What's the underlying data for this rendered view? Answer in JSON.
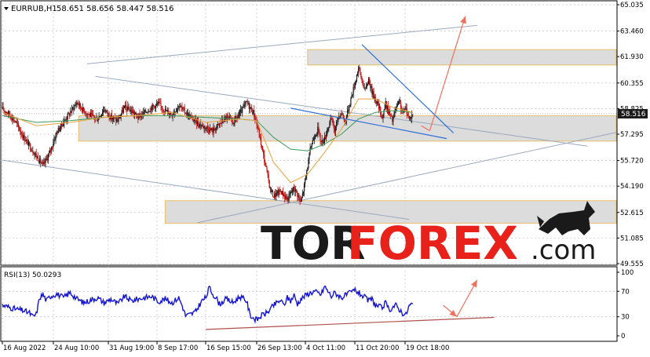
{
  "header": {
    "symbol_label": "EURRUB,H1",
    "ohlc_text": "58.651 58.656 58.447 58.516"
  },
  "watermark": {
    "part1": "TOR",
    "part2": "FOREX",
    "part3": ".com",
    "color_dark": "#1a1a1a",
    "color_accent": "#e8211b"
  },
  "colors": {
    "bull_candle": "#1a1a1a",
    "bear_candle": "#c01010",
    "ma_fast": "#e8a33a",
    "ma_slow": "#3c9a5a",
    "zone_fill": "#d9d9d9",
    "zone_border": "#e6b85a",
    "trend_blue": "#2f6fd6",
    "channel_gray": "#9aa9bf",
    "forecast_red": "#f07060",
    "rsi_line": "#1515d0",
    "rsi_trend": "#b05050"
  },
  "chart_data": {
    "type": "candlestick",
    "symbol": "EURRUB",
    "timeframe": "H1",
    "ylim": [
      49.555,
      65.035
    ],
    "y_ticks": [
      65.035,
      63.46,
      61.93,
      60.355,
      58.825,
      57.295,
      55.72,
      54.19,
      52.615,
      51.085,
      49.555
    ],
    "y_tick_labels": [
      "65.035",
      "63.460",
      "61.930",
      "60.355",
      "58.825",
      "57.295",
      "55.720",
      "54.190",
      "52.615",
      "51.085",
      "49.555"
    ],
    "current_price": 58.516,
    "current_price_label": "58.516",
    "x_tick_labels": [
      "16 Aug 2022",
      "24 Aug 10:00",
      "31 Aug 19:00",
      "8 Sep 17:00",
      "16 Sep 15:00",
      "26 Sep 13:00",
      "4 Oct 11:00",
      "11 Oct 20:00",
      "19 Oct 18:00"
    ],
    "price_path": [
      [
        0,
        58.8
      ],
      [
        4,
        58.5
      ],
      [
        8,
        58.0
      ],
      [
        12,
        57.2
      ],
      [
        16,
        56.6
      ],
      [
        20,
        56.0
      ],
      [
        24,
        55.4
      ],
      [
        28,
        56.2
      ],
      [
        32,
        57.4
      ],
      [
        36,
        58.0
      ],
      [
        40,
        58.6
      ],
      [
        44,
        59.2
      ],
      [
        48,
        58.7
      ],
      [
        52,
        58.4
      ],
      [
        56,
        58.2
      ],
      [
        60,
        58.8
      ],
      [
        64,
        58.3
      ],
      [
        68,
        58.1
      ],
      [
        72,
        58.9
      ],
      [
        76,
        58.7
      ],
      [
        80,
        58.3
      ],
      [
        84,
        58.6
      ],
      [
        88,
        58.9
      ],
      [
        92,
        59.1
      ],
      [
        96,
        58.7
      ],
      [
        100,
        58.5
      ],
      [
        104,
        59.0
      ],
      [
        108,
        58.6
      ],
      [
        112,
        58.2
      ],
      [
        116,
        57.9
      ],
      [
        120,
        57.7
      ],
      [
        124,
        57.5
      ],
      [
        128,
        57.9
      ],
      [
        132,
        58.3
      ],
      [
        136,
        58.0
      ],
      [
        140,
        58.5
      ],
      [
        144,
        59.2
      ],
      [
        148,
        58.6
      ],
      [
        150,
        57.9
      ],
      [
        152,
        57.0
      ],
      [
        154,
        56.0
      ],
      [
        156,
        55.0
      ],
      [
        158,
        54.0
      ],
      [
        160,
        53.6
      ],
      [
        164,
        53.9
      ],
      [
        168,
        53.4
      ],
      [
        172,
        54.1
      ],
      [
        174,
        53.7
      ],
      [
        176,
        53.2
      ],
      [
        178,
        54.2
      ],
      [
        180,
        55.4
      ],
      [
        182,
        56.6
      ],
      [
        184,
        57.2
      ],
      [
        186,
        57.6
      ],
      [
        188,
        56.8
      ],
      [
        190,
        57.0
      ],
      [
        192,
        57.7
      ],
      [
        194,
        58.2
      ],
      [
        196,
        57.5
      ],
      [
        198,
        58.3
      ],
      [
        200,
        58.6
      ],
      [
        202,
        58.0
      ],
      [
        204,
        58.8
      ],
      [
        206,
        59.6
      ],
      [
        208,
        60.4
      ],
      [
        210,
        61.3
      ],
      [
        212,
        60.5
      ],
      [
        214,
        59.9
      ],
      [
        216,
        60.6
      ],
      [
        218,
        59.8
      ],
      [
        220,
        59.4
      ],
      [
        222,
        58.9
      ],
      [
        224,
        58.3
      ],
      [
        226,
        59.1
      ],
      [
        228,
        58.6
      ],
      [
        230,
        58.1
      ],
      [
        232,
        58.8
      ],
      [
        234,
        59.2
      ],
      [
        236,
        58.6
      ],
      [
        238,
        58.8
      ],
      [
        240,
        58.2
      ],
      [
        242,
        58.516
      ]
    ],
    "ma_fast": [
      [
        0,
        58.6
      ],
      [
        20,
        57.8
      ],
      [
        40,
        58.0
      ],
      [
        60,
        58.3
      ],
      [
        80,
        58.4
      ],
      [
        100,
        58.6
      ],
      [
        120,
        58.0
      ],
      [
        140,
        58.2
      ],
      [
        150,
        58.1
      ],
      [
        160,
        55.6
      ],
      [
        170,
        54.4
      ],
      [
        180,
        54.9
      ],
      [
        190,
        56.2
      ],
      [
        200,
        57.6
      ],
      [
        210,
        59.4
      ],
      [
        220,
        59.4
      ],
      [
        230,
        58.9
      ],
      [
        242,
        58.6
      ]
    ],
    "ma_slow": [
      [
        0,
        58.4
      ],
      [
        20,
        58.0
      ],
      [
        40,
        58.1
      ],
      [
        60,
        58.3
      ],
      [
        80,
        58.4
      ],
      [
        100,
        58.4
      ],
      [
        120,
        58.3
      ],
      [
        140,
        58.2
      ],
      [
        150,
        58.1
      ],
      [
        160,
        57.1
      ],
      [
        170,
        56.4
      ],
      [
        180,
        56.3
      ],
      [
        190,
        56.7
      ],
      [
        200,
        57.3
      ],
      [
        210,
        58.2
      ],
      [
        220,
        58.6
      ],
      [
        230,
        58.7
      ],
      [
        242,
        58.6
      ]
    ],
    "zones": [
      {
        "x0": 180,
        "x1": 362,
        "y0": 61.43,
        "y1": 62.35
      },
      {
        "x0": 45,
        "x1": 362,
        "y0": 56.88,
        "y1": 58.4
      },
      {
        "x0": 96,
        "x1": 362,
        "y0": 51.97,
        "y1": 53.32
      }
    ],
    "lines": [
      {
        "kind": "channel",
        "x0": 50,
        "y0": 61.5,
        "x1": 280,
        "y1": 63.8
      },
      {
        "kind": "channel",
        "x0": 55,
        "y0": 60.75,
        "x1": 345,
        "y1": 56.58
      },
      {
        "kind": "channel",
        "x0": 0,
        "y0": 55.74,
        "x1": 240,
        "y1": 52.2
      },
      {
        "kind": "channel",
        "x0": 115,
        "y0": 52.0,
        "x1": 362,
        "y1": 57.4
      },
      {
        "kind": "trend",
        "x0": 170,
        "y0": 58.85,
        "x1": 262,
        "y1": 57.03
      },
      {
        "kind": "trend",
        "x0": 212,
        "y0": 62.65,
        "x1": 266,
        "y1": 57.37
      },
      {
        "kind": "forecast",
        "x0": 252,
        "y0": 57.5,
        "x1": 273,
        "y1": 64.35
      }
    ],
    "forecast_small_line": [
      [
        247,
        57.8
      ],
      [
        252,
        57.5
      ]
    ],
    "rsi": {
      "label": "RSI(13) 50.0293",
      "ylim": [
        0,
        100
      ],
      "y_ticks": [
        100,
        70,
        30,
        0
      ],
      "y_tick_labels": [
        "100",
        "70",
        "30",
        "0"
      ],
      "values": [
        [
          0,
          48
        ],
        [
          4,
          45
        ],
        [
          8,
          42
        ],
        [
          12,
          40
        ],
        [
          16,
          36
        ],
        [
          18,
          30
        ],
        [
          20,
          34
        ],
        [
          22,
          60
        ],
        [
          24,
          65
        ],
        [
          26,
          55
        ],
        [
          28,
          62
        ],
        [
          32,
          66
        ],
        [
          36,
          60
        ],
        [
          40,
          68
        ],
        [
          44,
          58
        ],
        [
          48,
          52
        ],
        [
          52,
          56
        ],
        [
          56,
          60
        ],
        [
          60,
          52
        ],
        [
          64,
          58
        ],
        [
          68,
          50
        ],
        [
          72,
          62
        ],
        [
          76,
          55
        ],
        [
          80,
          58
        ],
        [
          84,
          60
        ],
        [
          88,
          62
        ],
        [
          92,
          54
        ],
        [
          96,
          58
        ],
        [
          100,
          52
        ],
        [
          104,
          60
        ],
        [
          106,
          48
        ],
        [
          108,
          32
        ],
        [
          110,
          33
        ],
        [
          112,
          35
        ],
        [
          114,
          38
        ],
        [
          116,
          48
        ],
        [
          118,
          56
        ],
        [
          120,
          60
        ],
        [
          122,
          76
        ],
        [
          124,
          66
        ],
        [
          126,
          60
        ],
        [
          128,
          50
        ],
        [
          132,
          58
        ],
        [
          136,
          52
        ],
        [
          140,
          62
        ],
        [
          144,
          55
        ],
        [
          146,
          33
        ],
        [
          148,
          28
        ],
        [
          150,
          25
        ],
        [
          152,
          30
        ],
        [
          154,
          34
        ],
        [
          156,
          36
        ],
        [
          158,
          42
        ],
        [
          160,
          48
        ],
        [
          162,
          52
        ],
        [
          164,
          56
        ],
        [
          166,
          48
        ],
        [
          168,
          60
        ],
        [
          170,
          55
        ],
        [
          172,
          64
        ],
        [
          174,
          50
        ],
        [
          176,
          58
        ],
        [
          178,
          62
        ],
        [
          180,
          66
        ],
        [
          184,
          70
        ],
        [
          188,
          65
        ],
        [
          190,
          78
        ],
        [
          192,
          70
        ],
        [
          194,
          62
        ],
        [
          196,
          68
        ],
        [
          200,
          60
        ],
        [
          204,
          66
        ],
        [
          208,
          72
        ],
        [
          212,
          64
        ],
        [
          216,
          55
        ],
        [
          218,
          58
        ],
        [
          220,
          48
        ],
        [
          222,
          46
        ],
        [
          224,
          44
        ],
        [
          226,
          52
        ],
        [
          228,
          40
        ],
        [
          230,
          45
        ],
        [
          232,
          48
        ],
        [
          234,
          42
        ],
        [
          236,
          36
        ],
        [
          238,
          33
        ],
        [
          240,
          48
        ],
        [
          242,
          50
        ]
      ],
      "trend": {
        "x0": 120,
        "y0": 10,
        "x1": 290,
        "y1": 29
      },
      "forecast_down": [
        [
          260,
          48
        ],
        [
          268,
          30
        ]
      ],
      "forecast_up": [
        [
          268,
          30
        ],
        [
          280,
          88
        ]
      ]
    }
  }
}
